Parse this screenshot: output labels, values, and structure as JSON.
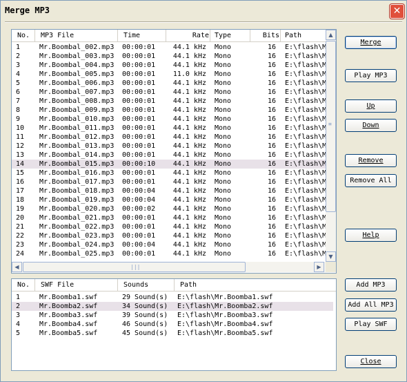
{
  "window": {
    "title": "Merge MP3",
    "close_glyph": "✕"
  },
  "mp3_list": {
    "columns": [
      "No.",
      "MP3 File",
      "Time",
      "Rate",
      "Type",
      "Bits",
      "Path"
    ],
    "selected_row": 13,
    "rows": [
      [
        "1",
        "Mr.Boombal_002.mp3",
        "00:00:01",
        "44.1 kHz",
        "Mono",
        "16",
        "E:\\flash\\M"
      ],
      [
        "2",
        "Mr.Boombal_003.mp3",
        "00:00:01",
        "44.1 kHz",
        "Mono",
        "16",
        "E:\\flash\\M"
      ],
      [
        "3",
        "Mr.Boombal_004.mp3",
        "00:00:01",
        "44.1 kHz",
        "Mono",
        "16",
        "E:\\flash\\M"
      ],
      [
        "4",
        "Mr.Boombal_005.mp3",
        "00:00:01",
        "11.0 kHz",
        "Mono",
        "16",
        "E:\\flash\\M"
      ],
      [
        "5",
        "Mr.Boombal_006.mp3",
        "00:00:01",
        "44.1 kHz",
        "Mono",
        "16",
        "E:\\flash\\M"
      ],
      [
        "6",
        "Mr.Boombal_007.mp3",
        "00:00:01",
        "44.1 kHz",
        "Mono",
        "16",
        "E:\\flash\\M"
      ],
      [
        "7",
        "Mr.Boombal_008.mp3",
        "00:00:01",
        "44.1 kHz",
        "Mono",
        "16",
        "E:\\flash\\M"
      ],
      [
        "8",
        "Mr.Boombal_009.mp3",
        "00:00:01",
        "44.1 kHz",
        "Mono",
        "16",
        "E:\\flash\\M"
      ],
      [
        "9",
        "Mr.Boombal_010.mp3",
        "00:00:01",
        "44.1 kHz",
        "Mono",
        "16",
        "E:\\flash\\M"
      ],
      [
        "10",
        "Mr.Boombal_011.mp3",
        "00:00:01",
        "44.1 kHz",
        "Mono",
        "16",
        "E:\\flash\\M"
      ],
      [
        "11",
        "Mr.Boombal_012.mp3",
        "00:00:01",
        "44.1 kHz",
        "Mono",
        "16",
        "E:\\flash\\M"
      ],
      [
        "12",
        "Mr.Boombal_013.mp3",
        "00:00:01",
        "44.1 kHz",
        "Mono",
        "16",
        "E:\\flash\\M"
      ],
      [
        "13",
        "Mr.Boombal_014.mp3",
        "00:00:01",
        "44.1 kHz",
        "Mono",
        "16",
        "E:\\flash\\M"
      ],
      [
        "14",
        "Mr.Boombal_015.mp3",
        "00:00:10",
        "44.1 kHz",
        "Mono",
        "16",
        "E:\\flash\\M"
      ],
      [
        "15",
        "Mr.Boombal_016.mp3",
        "00:00:01",
        "44.1 kHz",
        "Mono",
        "16",
        "E:\\flash\\M"
      ],
      [
        "16",
        "Mr.Boombal_017.mp3",
        "00:00:01",
        "44.1 kHz",
        "Mono",
        "16",
        "E:\\flash\\M"
      ],
      [
        "17",
        "Mr.Boombal_018.mp3",
        "00:00:04",
        "44.1 kHz",
        "Mono",
        "16",
        "E:\\flash\\M"
      ],
      [
        "18",
        "Mr.Boombal_019.mp3",
        "00:00:04",
        "44.1 kHz",
        "Mono",
        "16",
        "E:\\flash\\M"
      ],
      [
        "19",
        "Mr.Boombal_020.mp3",
        "00:00:02",
        "44.1 kHz",
        "Mono",
        "16",
        "E:\\flash\\M"
      ],
      [
        "20",
        "Mr.Boombal_021.mp3",
        "00:00:01",
        "44.1 kHz",
        "Mono",
        "16",
        "E:\\flash\\M"
      ],
      [
        "21",
        "Mr.Boombal_022.mp3",
        "00:00:01",
        "44.1 kHz",
        "Mono",
        "16",
        "E:\\flash\\M"
      ],
      [
        "22",
        "Mr.Boombal_023.mp3",
        "00:00:01",
        "44.1 kHz",
        "Mono",
        "16",
        "E:\\flash\\M"
      ],
      [
        "23",
        "Mr.Boombal_024.mp3",
        "00:00:04",
        "44.1 kHz",
        "Mono",
        "16",
        "E:\\flash\\M"
      ],
      [
        "24",
        "Mr.Boombal_025.mp3",
        "00:00:01",
        "44.1 kHz",
        "Mono",
        "16",
        "E:\\flash\\M"
      ]
    ],
    "vscroll": {
      "up_icon": "▲",
      "down_icon": "▼",
      "grip_icon": "≡"
    },
    "hscroll": {
      "left_icon": "◀",
      "right_icon": "▶",
      "grip_icon": "|||"
    }
  },
  "swf_list": {
    "columns": [
      "No.",
      "SWF File",
      "Sounds",
      "Path"
    ],
    "selected_row": 1,
    "rows": [
      [
        "1",
        "Mr.Boomba1.swf",
        "29 Sound(s)",
        "E:\\flash\\Mr.Boomba1.swf"
      ],
      [
        "2",
        "Mr.Boomba2.swf",
        "34 Sound(s)",
        "E:\\flash\\Mr.Boomba2.swf"
      ],
      [
        "3",
        "Mr.Boomba3.swf",
        "39 Sound(s)",
        "E:\\flash\\Mr.Boomba3.swf"
      ],
      [
        "4",
        "Mr.Boomba4.swf",
        "46 Sound(s)",
        "E:\\flash\\Mr.Boomba4.swf"
      ],
      [
        "5",
        "Mr.Boomba5.swf",
        "45 Sound(s)",
        "E:\\flash\\Mr.Boomba5.swf"
      ]
    ]
  },
  "buttons": {
    "merge": "Merge",
    "play_mp3": "Play MP3",
    "up": "Up",
    "down": "Down",
    "remove": "Remove",
    "remove_all": "Remove All",
    "help": "Help",
    "add_mp3": "Add MP3",
    "add_all_mp3": "Add All MP3",
    "play_swf": "Play SWF",
    "close": "Close"
  }
}
